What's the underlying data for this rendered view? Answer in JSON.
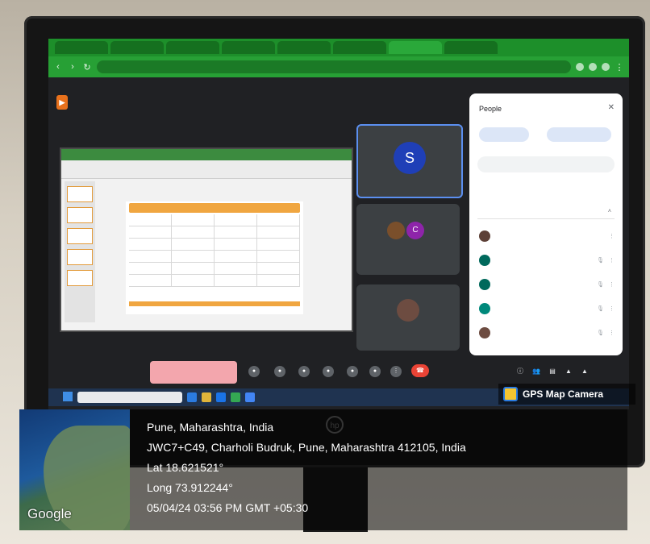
{
  "browser": {
    "tabs": [
      "",
      "",
      "",
      "",
      "",
      "",
      "",
      ""
    ],
    "active_tab_index": 6,
    "address": "",
    "tab_color": "#1d8f2a"
  },
  "meet": {
    "title": "",
    "tiles": [
      {
        "initial": "S",
        "name": "",
        "avatar_color": "#1f3fb7"
      },
      {
        "initial": "C",
        "others_label": "",
        "avatar_color": "#8e24aa"
      },
      {
        "name": ""
      }
    ],
    "controls": {
      "time": "",
      "presenting_button": "",
      "end_call_icon": "phone-hangup-icon"
    }
  },
  "people_panel": {
    "title": "People",
    "add_people": "",
    "all_muted": "",
    "search_placeholder": "",
    "in_call": "",
    "contributors": "",
    "participants": [
      {
        "name": "",
        "avatar_color": "#5d4037"
      },
      {
        "name": "",
        "avatar_color": "#00695c"
      },
      {
        "name": "",
        "avatar_color": "#00695c"
      },
      {
        "name": "",
        "avatar_color": "#00897b"
      },
      {
        "name": "",
        "avatar_color": "#6d4c41"
      }
    ]
  },
  "taskbar": {
    "search_placeholder": ""
  },
  "gps": {
    "badge": "GPS Map Camera",
    "map_label": "Google",
    "lines": [
      "Pune, Maharashtra, India",
      "JWC7+C49, Charholi Budruk, Pune, Maharashtra 412105, India",
      "Lat 18.621521°",
      "Long 73.912244°",
      "05/04/24 03:56 PM GMT +05:30"
    ]
  }
}
